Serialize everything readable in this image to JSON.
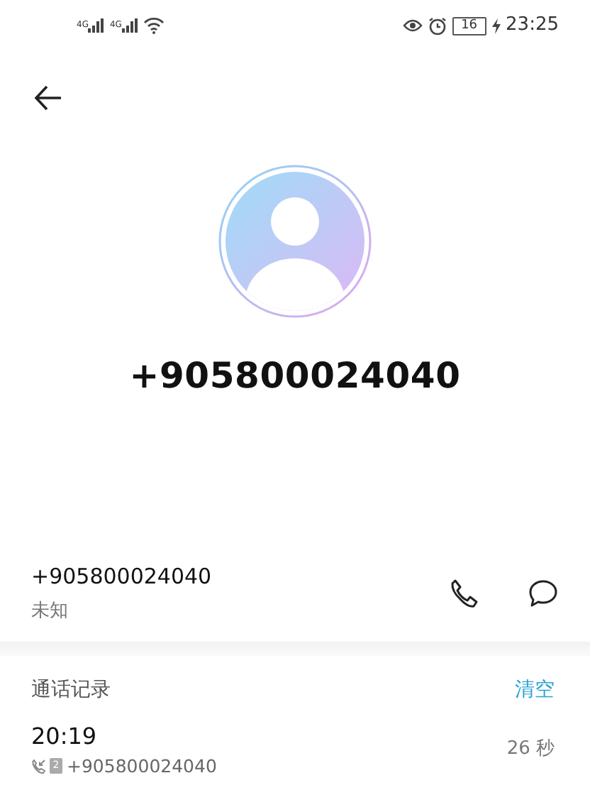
{
  "status_bar": {
    "signals": [
      {
        "label": "4G"
      },
      {
        "label": "4G"
      }
    ],
    "battery": "16",
    "time": "23:25"
  },
  "contact": {
    "number": "+905800024040"
  },
  "detail": {
    "number": "+905800024040",
    "label": "未知"
  },
  "call_log": {
    "title": "通话记录",
    "clear": "清空",
    "entries": [
      {
        "time": "20:19",
        "sim": "2",
        "number": "+905800024040",
        "duration": "26 秒"
      }
    ]
  }
}
